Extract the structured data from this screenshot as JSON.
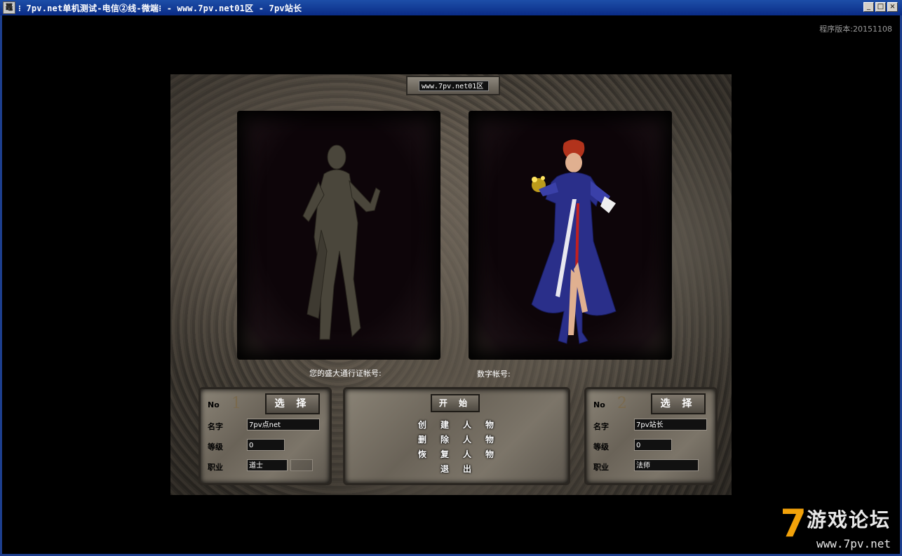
{
  "window": {
    "app_icon_glyph": "鼉",
    "title": "⁝ 7pv.net单机测试-电信②线-微端⁝ - www.7pv.net01区 - 7pv站长",
    "minimize": "_",
    "maximize": "□",
    "close": "×"
  },
  "version_text": "程序版本:20151108",
  "server": {
    "name": "www.7pv.net01区"
  },
  "account": {
    "pass_label": "您的盛大通行证帐号:",
    "digit_label": "数字帐号:"
  },
  "slots": [
    {
      "no_label": "No",
      "number": "1",
      "select_label": "选 择",
      "name_label": "名字",
      "name": "7pv点net",
      "level_label": "等级",
      "level": "0",
      "job_label": "职业",
      "job": "道士"
    },
    {
      "no_label": "No",
      "number": "2",
      "select_label": "选 择",
      "name_label": "名字",
      "name": "7pv站长",
      "level_label": "等级",
      "level": "0",
      "job_label": "职业",
      "job": "法师"
    }
  ],
  "menu": {
    "start": "开 始",
    "create": [
      "创",
      "建",
      "人",
      "物"
    ],
    "delete": [
      "删",
      "除",
      "人",
      "物"
    ],
    "restore": [
      "恢",
      "复",
      "人",
      "物"
    ],
    "exit": [
      "退",
      "出"
    ]
  },
  "watermark": {
    "seven": "7",
    "title": "游戏论坛",
    "url": "www.7pv.net"
  },
  "colors": {
    "titlebar": "#1d4fa8",
    "accent": "#f2a20a",
    "mage_robe": "#2a2f8a"
  }
}
